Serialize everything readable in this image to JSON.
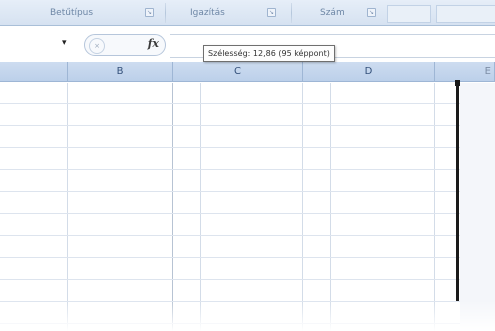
{
  "ribbon": {
    "groups": [
      {
        "label": "Betűtípus",
        "launcher": "dialog-launcher-icon"
      },
      {
        "label": "Igazítás",
        "launcher": "dialog-launcher-icon"
      },
      {
        "label": "Szám",
        "launcher": "dialog-launcher-icon"
      }
    ]
  },
  "formula_bar": {
    "fx_label": "fx",
    "cancel_symbol": "×",
    "dropdown_symbol": "▾"
  },
  "tooltip": "Szélesség: 12,86 (95 képpont)",
  "columns": [
    "B",
    "C",
    "D",
    "E"
  ],
  "colors": {
    "header_bg": "#c6d8ee",
    "grid_line": "#d3dce8",
    "resize_line": "#1a1a1a"
  }
}
